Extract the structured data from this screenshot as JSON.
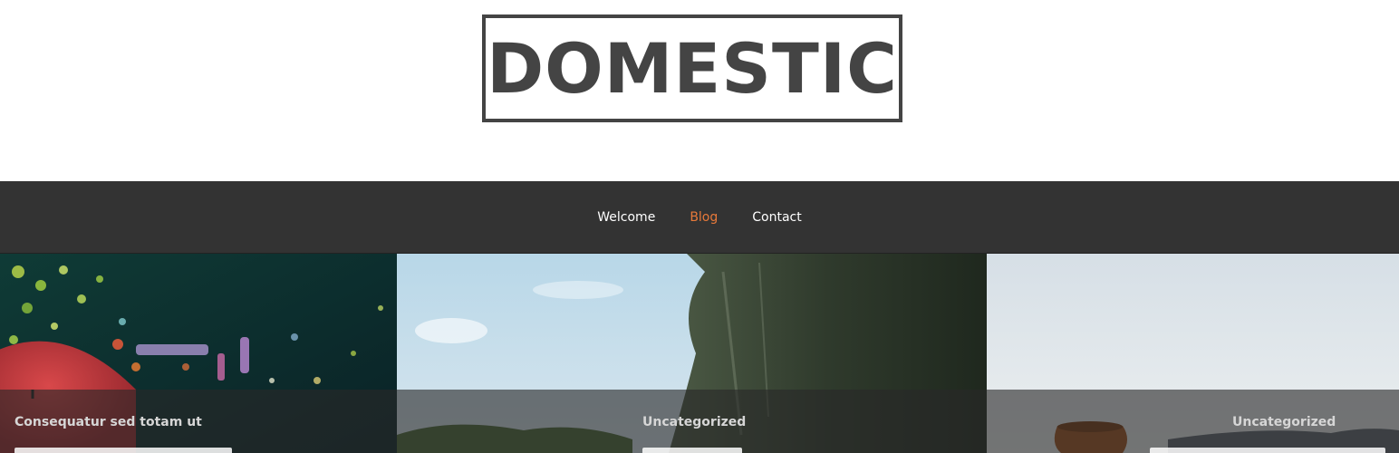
{
  "site": {
    "logo_text": "DOMESTIC"
  },
  "nav": {
    "items": [
      {
        "label": "Welcome"
      },
      {
        "label": "Blog"
      },
      {
        "label": "Contact"
      }
    ]
  },
  "posts": [
    {
      "category": "Consequatur sed totam ut"
    },
    {
      "category": "Uncategorized"
    },
    {
      "category": "Uncategorized"
    }
  ],
  "colors": {
    "nav_background": "#333333",
    "nav_active": "#e8793a",
    "logo": "#444444"
  }
}
